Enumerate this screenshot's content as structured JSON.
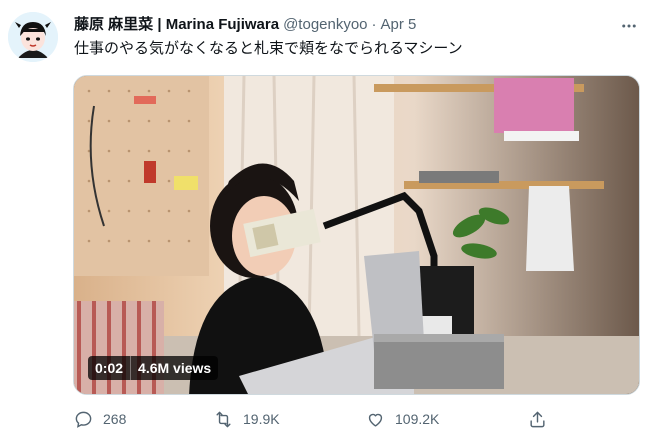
{
  "tweet": {
    "author_name": "藤原 麻里菜 | Marina Fujiwara",
    "handle": "@togenkyoo",
    "separator": "·",
    "time": "Apr 5",
    "text": "仕事のやる気がなくなると札束で頬をなでられるマシーン",
    "icons": {
      "more": "more-icon",
      "avatar": "avatar-illustration"
    }
  },
  "media": {
    "duration": "0:02",
    "views": "4.6M views",
    "badge_icon": "none"
  },
  "actions": {
    "reply_count": "268",
    "retweet_count": "19.9K",
    "like_count": "109.2K",
    "icons": {
      "reply": "reply-icon",
      "retweet": "retweet-icon",
      "like": "heart-icon",
      "share": "share-icon"
    }
  },
  "colors": {
    "text": "#0f1419",
    "secondary": "#536471",
    "border": "#cfd9de"
  }
}
